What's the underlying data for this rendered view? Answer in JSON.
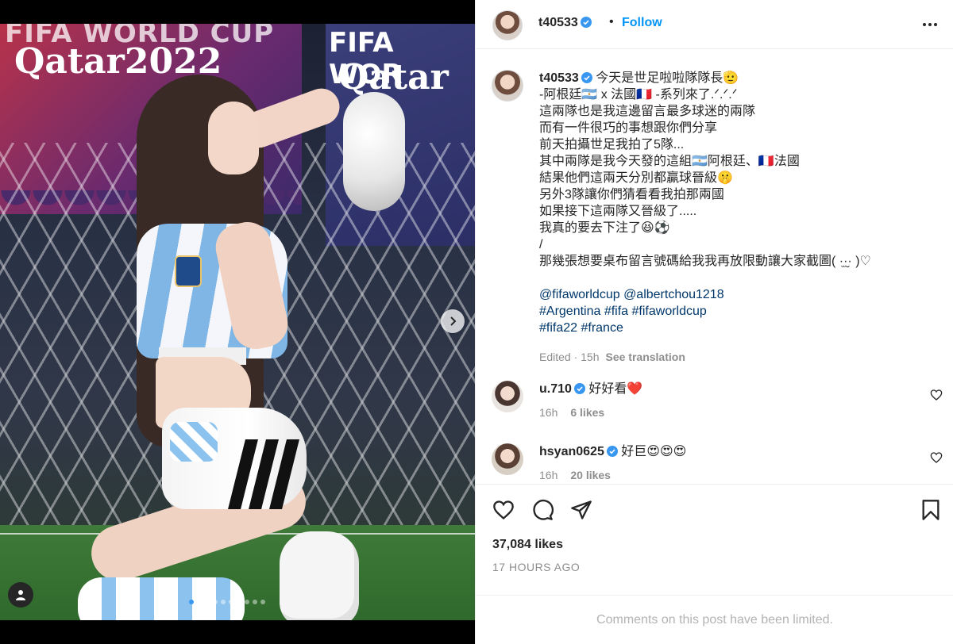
{
  "post": {
    "username": "t40533",
    "follow_label": "Follow",
    "header_separator": "•",
    "caption_lines": [
      "今天是世足啦啦隊隊長🫡",
      "-阿根廷🇦🇷 x 法國🇫🇷 -系列來了.ᐟ.ᐟ.ᐟ",
      "這兩隊也是我這邊留言最多球迷的兩隊",
      "而有一件很巧的事想跟你們分享",
      "前天拍攝世足我拍了5隊...",
      "其中兩隊是我今天發的這組🇦🇷阿根廷、🇫🇷法國",
      "結果他們這兩天分別都贏球晉級🤫",
      "另外3隊讓你們猜看看我拍那兩國",
      "如果接下這兩隊又晉級了.....",
      "我真的要去下注了😆⚽",
      "/",
      "那幾張想要桌布留言號碼給我我再放限動讓大家截圖( ·̫·̮· )♡"
    ],
    "mentions_line": "@fifaworldcup @albertchou1218",
    "hashtags_line_1": "#Argentina #fifa #fifaworldcup",
    "hashtags_line_2": "#fifa22 #france",
    "edited_label": "Edited · 15h",
    "see_translation": "See translation"
  },
  "comments": [
    {
      "username": "u.710",
      "text": "好好看❤️",
      "time": "16h",
      "likes": "6 likes"
    },
    {
      "username": "hsyan0625",
      "text": "好巨😍😍😍",
      "time": "16h",
      "likes": "20 likes"
    }
  ],
  "actions": {
    "icons": [
      "heart-icon",
      "comment-icon",
      "share-icon",
      "bookmark-icon"
    ],
    "likes_count": "37,084 likes",
    "posted_time": "17 HOURS AGO",
    "comments_limited": "Comments on this post have been limited."
  },
  "media": {
    "banner_line_1": "FIFA WORLD CUP",
    "banner_line_2": "Qatar2022",
    "banner_line_3": "FIFA WOR",
    "banner_line_4": "Qatar",
    "carousel_count": 10,
    "carousel_active": 1
  },
  "colors": {
    "accent_blue": "#0095f6",
    "link_blue": "#00376b",
    "muted_gray": "#8e8e8e",
    "divider": "#efefef"
  }
}
